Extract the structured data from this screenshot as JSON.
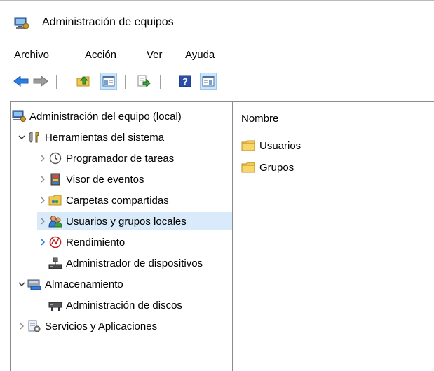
{
  "window": {
    "title": "Administración de equipos"
  },
  "menu": {
    "items": [
      "Archivo",
      "Acción",
      "Ver",
      "Ayuda"
    ]
  },
  "toolbar": {
    "buttons": [
      {
        "icon": "back-arrow-icon"
      },
      {
        "icon": "forward-arrow-icon"
      },
      {
        "icon": "up-folder-icon"
      },
      {
        "icon": "show-hide-console-tree-icon",
        "active": true
      },
      {
        "icon": "export-list-icon"
      },
      {
        "icon": "help-icon"
      },
      {
        "icon": "show-hide-action-pane-icon",
        "active": true
      }
    ]
  },
  "tree": {
    "root": "Administración del equipo (local)",
    "items": [
      {
        "label": "Herramientas del sistema",
        "level": 1,
        "expanded": true,
        "icon": "system-tools-icon"
      },
      {
        "label": "Programador de tareas",
        "level": 2,
        "icon": "clock-icon"
      },
      {
        "label": "Visor de eventos",
        "level": 2,
        "icon": "event-viewer-icon"
      },
      {
        "label": "Carpetas compartidas",
        "level": 2,
        "icon": "shared-folders-icon"
      },
      {
        "label": "Usuarios y grupos locales",
        "level": 2,
        "selected": true,
        "icon": "users-groups-icon"
      },
      {
        "label": "Rendimiento",
        "level": 2,
        "icon": "performance-icon"
      },
      {
        "label": "Administrador de dispositivos",
        "level": 2,
        "icon": "device-manager-icon"
      },
      {
        "label": "Almacenamiento",
        "level": 1,
        "expanded": true,
        "icon": "storage-icon"
      },
      {
        "label": "Administración de discos",
        "level": 2,
        "icon": "disk-management-icon"
      },
      {
        "label": "Servicios y Aplicaciones",
        "level": 1,
        "icon": "services-icon"
      }
    ]
  },
  "list": {
    "column_header": "Nombre",
    "items": [
      "Usuarios",
      "Grupos"
    ]
  },
  "colors": {
    "selection_bg": "#d9ebfa",
    "toolbar_active": "#cce4f7",
    "folder": "#f2c94c",
    "arrow_blue": "#2a7de1"
  }
}
